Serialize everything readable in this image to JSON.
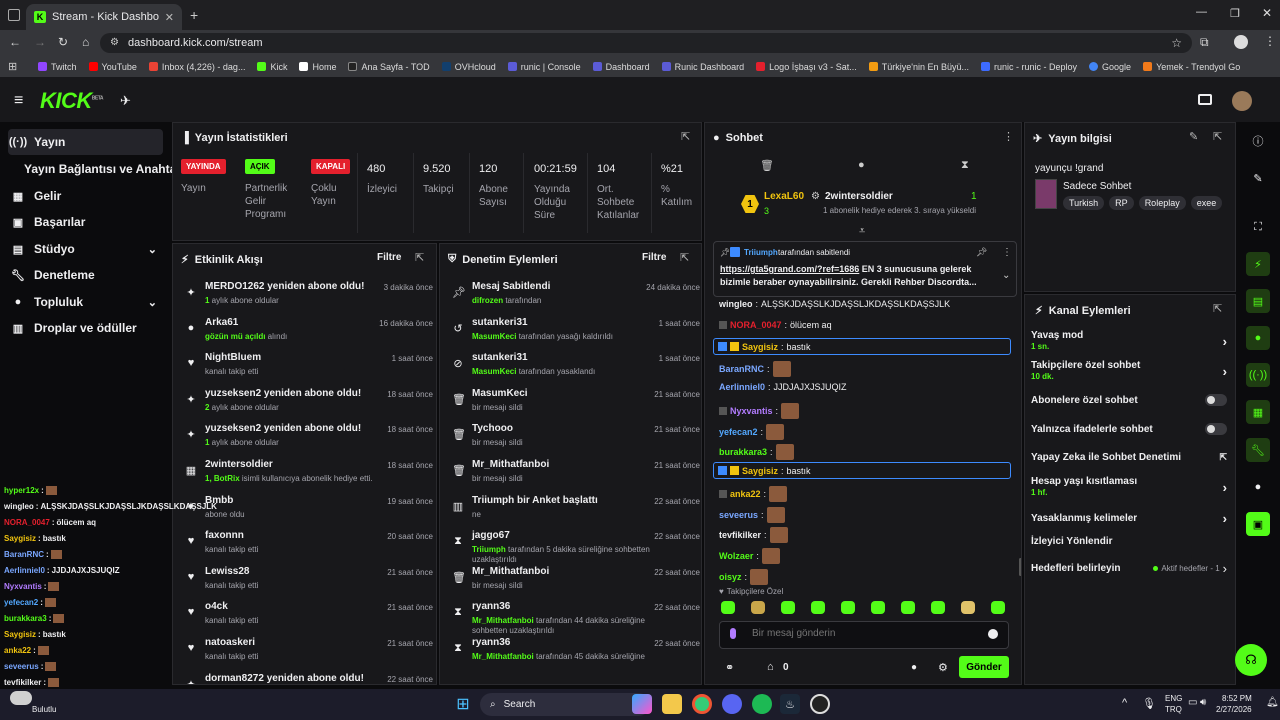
{
  "browser": {
    "tab_title": "Stream - Kick Dashboard",
    "url": "dashboard.kick.com/stream",
    "bookmarks": [
      "Twitch",
      "YouTube",
      "Inbox (4,226) - dag...",
      "Kick",
      "Home",
      "Ana Sayfa - TOD",
      "OVHcloud",
      "runic | Console",
      "Dashboard",
      "Runic Dashboard",
      "Logo İşbaşı v3 - Sat...",
      "Türkiye'nin En Büyü...",
      "runic - runic - Deploy",
      "Google",
      "Yemek - Trendyol Go"
    ]
  },
  "header": {
    "logo": "KICK",
    "beta": "BETA"
  },
  "sidebar": {
    "items": [
      {
        "label": "Yayın",
        "icon": "broadcast-icon"
      },
      {
        "label": "Yayın Bağlantısı ve Anahtarı",
        "icon": ""
      },
      {
        "label": "Gelir",
        "icon": "money-icon"
      },
      {
        "label": "Başarılar",
        "icon": "trophy-icon"
      },
      {
        "label": "Stüdyo",
        "icon": "studio-icon"
      },
      {
        "label": "Denetleme",
        "icon": "wrench-icon"
      },
      {
        "label": "Topluluk",
        "icon": "people-icon"
      },
      {
        "label": "Droplar ve ödüller",
        "icon": "gift-icon"
      }
    ]
  },
  "stats": {
    "title": "Yayın İstatistikleri",
    "items": [
      {
        "value": "YAYINDA",
        "label": "Yayın",
        "badge": true,
        "color": "#e4202d"
      },
      {
        "value": "AÇIK",
        "label": "Partnerlik Gelir Programı",
        "badge": true,
        "color": "#53fc18"
      },
      {
        "value": "KAPALI",
        "label": "Çoklu Yayın",
        "badge": true,
        "color": "#e4202d"
      },
      {
        "value": "480",
        "label": "İzleyici"
      },
      {
        "value": "9.520",
        "label": "Takipçi"
      },
      {
        "value": "120",
        "label": "Abone Sayısı"
      },
      {
        "value": "00:21:59",
        "label": "Yayında Olduğu Süre"
      },
      {
        "value": "104",
        "label": "Ort. Sohbete Katılanlar"
      },
      {
        "value": "%21",
        "label": "% Katılım"
      }
    ]
  },
  "activity": {
    "title": "Etkinlik Akışı",
    "filter": "Filtre",
    "items": [
      {
        "title": "MERDO1262 yeniden abone oldu!",
        "sub_g": "1",
        "sub": " aylık abone oldular",
        "time": "3 dakika önce",
        "icon": "sparkle-icon"
      },
      {
        "title": "Arka61",
        "sub_g": "gözün mü açıldı",
        "sub": " alındı",
        "time": "16 dakika önce",
        "icon": "reward-icon"
      },
      {
        "title": "NightBluem",
        "sub_g": "",
        "sub": "kanalı takip etti",
        "time": "1 saat önce",
        "icon": "heart-icon"
      },
      {
        "title": "yuzseksen2 yeniden abone oldu!",
        "sub_g": "2",
        "sub": " aylık abone oldular",
        "time": "18 saat önce",
        "icon": "sparkle-icon"
      },
      {
        "title": "yuzseksen2 yeniden abone oldu!",
        "sub_g": "1",
        "sub": " aylık abone oldular",
        "time": "18 saat önce",
        "icon": "sparkle-icon"
      },
      {
        "title": "2wintersoldier",
        "sub_g": "1, BotRix",
        "sub": " isimli kullanıcıya abonelik hediye etti.",
        "time": "18 saat önce",
        "icon": "gift-icon"
      },
      {
        "title": "Bmbb",
        "sub_g": "",
        "sub": "abone oldu",
        "time": "19 saat önce",
        "icon": "sparkle-icon"
      },
      {
        "title": "faxonnn",
        "sub_g": "",
        "sub": "kanalı takip etti",
        "time": "20 saat önce",
        "icon": "heart-icon"
      },
      {
        "title": "Lewiss28",
        "sub_g": "",
        "sub": "kanalı takip etti",
        "time": "21 saat önce",
        "icon": "heart-icon"
      },
      {
        "title": "o4ck",
        "sub_g": "",
        "sub": "kanalı takip etti",
        "time": "21 saat önce",
        "icon": "heart-icon"
      },
      {
        "title": "natoaskeri",
        "sub_g": "",
        "sub": "kanalı takip etti",
        "time": "21 saat önce",
        "icon": "heart-icon"
      },
      {
        "title": "dorman8272 yeniden abone oldu!",
        "sub_g": "",
        "sub": "",
        "time": "22 saat önce",
        "icon": "sparkle-icon"
      }
    ]
  },
  "moderation": {
    "title": "Denetim Eylemleri",
    "filter": "Filtre",
    "items": [
      {
        "title": "Mesaj Sabitlendi",
        "sub_g": "difrozen",
        "sub": " tarafından",
        "time": "24 dakika önce",
        "icon": "pin-icon"
      },
      {
        "title": "sutankeri31",
        "sub_g": "MasumKeci",
        "sub": " tarafından yasağı kaldırıldı",
        "time": "1 saat önce",
        "icon": "unban-icon"
      },
      {
        "title": "sutankeri31",
        "sub_g": "MasumKeci",
        "sub": " tarafından yasaklandı",
        "time": "1 saat önce",
        "icon": "ban-icon"
      },
      {
        "title": "MasumKeci",
        "sub_g": "",
        "sub": "bir mesajı sildi",
        "time": "21 saat önce",
        "icon": "trash-icon"
      },
      {
        "title": "Tychooo",
        "sub_g": "",
        "sub": "bir mesajı sildi",
        "time": "21 saat önce",
        "icon": "trash-icon"
      },
      {
        "title": "Mr_Mithatfanboi",
        "sub_g": "",
        "sub": "bir mesajı sildi",
        "time": "21 saat önce",
        "icon": "trash-icon"
      },
      {
        "title": "Triiumph bir Anket başlattı",
        "sub_g": "",
        "sub": "ne",
        "time": "22 saat önce",
        "icon": "poll-icon"
      },
      {
        "title": "jaggo67",
        "sub_g": "Triiumph",
        "sub": " tarafından 5 dakika süreliğine sohbetten uzaklaştırıldı",
        "time": "22 saat önce",
        "icon": "timer-icon"
      },
      {
        "title": "Mr_Mithatfanboi",
        "sub_g": "",
        "sub": "bir mesajı sildi",
        "time": "22 saat önce",
        "icon": "trash-icon"
      },
      {
        "title": "ryann36",
        "sub_g": "Mr_Mithatfanboi",
        "sub": " tarafından 44 dakika süreliğine sohbetten uzaklaştırıldı",
        "time": "22 saat önce",
        "icon": "timer-icon"
      },
      {
        "title": "ryann36",
        "sub_g": "Mr_Mithatfanboi",
        "sub": " tarafından 45 dakika süreliğine",
        "time": "22 saat önce",
        "icon": "timer-icon"
      }
    ]
  },
  "chat": {
    "title": "Sohbet",
    "leader1": {
      "name": "LexaL60",
      "count": "3"
    },
    "leader2": {
      "name": "2wintersoldier",
      "count": "1",
      "sub": "1 abonelik hediye ederek 3. sıraya yükseldi"
    },
    "pinned": {
      "user": "Triiumph",
      "by": "tarafından sabitlendi",
      "link": "https://gta5grand.com/?ref=1686",
      "text": " EN 3 sunucusuna gelerek bizimle beraber oynayabilirsiniz. Gerekli Rehber Discordta..."
    },
    "messages": [
      {
        "user": "wingleo",
        "color": "#efeff1",
        "text": "ALŞSKJDAŞSLKJDAŞSLJKDAŞSLKDAŞSJLK"
      },
      {
        "user": "NORA_0047",
        "color": "#e4202d",
        "text": "ölücem aq"
      },
      {
        "user": "Saygisiz",
        "color": "#f1c40f",
        "text": "bastık"
      },
      {
        "user": "BaranRNC",
        "color": "#7aa7ff",
        "text": ""
      },
      {
        "user": "Aerlinniel0",
        "color": "#7aa7ff",
        "text": "JJDJAJXJSJUQIZ"
      },
      {
        "user": "Nyxvantis",
        "color": "#b27cff",
        "text": ""
      },
      {
        "user": "yefecan2",
        "color": "#53a8ff",
        "text": ""
      },
      {
        "user": "burakkara3",
        "color": "#53fc18",
        "text": ""
      },
      {
        "user": "Saygisiz",
        "color": "#f1c40f",
        "text": "bastık"
      },
      {
        "user": "anka22",
        "color": "#f1c40f",
        "text": ""
      },
      {
        "user": "seveerus",
        "color": "#7aa7ff",
        "text": ""
      },
      {
        "user": "tevfikilker",
        "color": "#efeff1",
        "text": ""
      },
      {
        "user": "Wolzaer",
        "color": "#53fc18",
        "text": ""
      },
      {
        "user": "oisyz",
        "color": "#53fc18",
        "text": ""
      }
    ],
    "emote_label": "Takipçilere Özel",
    "input_placeholder": "Bir mesaj gönderin",
    "points": "0",
    "send": "Gönder"
  },
  "stream_info": {
    "title": "Yayın bilgisi",
    "streamer": "yayunçu !grand",
    "category": "Sadece Sohbet",
    "tags": [
      "Turkish",
      "RP",
      "Roleplay",
      "exee"
    ]
  },
  "channel_actions": {
    "title": "Kanal Eylemleri",
    "items": [
      {
        "label": "Yavaş mod",
        "sub": "1 sn.",
        "type": "arrow"
      },
      {
        "label": "Takipçilere özel sohbet",
        "sub": "10 dk.",
        "type": "arrow"
      },
      {
        "label": "Abonelere özel sohbet",
        "sub": "",
        "type": "toggle"
      },
      {
        "label": "Yalnızca ifadelerle sohbet",
        "sub": "",
        "type": "toggle"
      },
      {
        "label": "Yapay Zeka ile Sohbet Denetimi",
        "sub": "",
        "type": "ext"
      },
      {
        "label": "Hesap yaşı kısıtlaması",
        "sub": "1 hf.",
        "type": "arrow"
      },
      {
        "label": "Yasaklanmış kelimeler",
        "sub": "",
        "type": "arrow"
      },
      {
        "label": "İzleyici Yönlendir",
        "sub": "",
        "type": "none"
      },
      {
        "label": "Hedefleri belirleyin",
        "sub": "",
        "type": "goal",
        "extra": "Aktif hedefler - 1"
      }
    ]
  },
  "overlay_chat": [
    {
      "user": "hyper12x",
      "color": "#53fc18",
      "text": ""
    },
    {
      "user": "wingleo",
      "color": "#efeff1",
      "text": "ALŞSKJDAŞSLKJDAŞSLJKDAŞSLKDAŞSJLK"
    },
    {
      "user": "NORA_0047",
      "color": "#e4202d",
      "text": "ölücem aq"
    },
    {
      "user": "Saygisiz",
      "color": "#f1c40f",
      "text": "bastık"
    },
    {
      "user": "BaranRNC",
      "color": "#7aa7ff",
      "text": ""
    },
    {
      "user": "Aerlinniel0",
      "color": "#7aa7ff",
      "text": "JJDJAJXJSJUQIZ"
    },
    {
      "user": "Nyxvantis",
      "color": "#b27cff",
      "text": ""
    },
    {
      "user": "yefecan2",
      "color": "#53a8ff",
      "text": ""
    },
    {
      "user": "burakkara3",
      "color": "#53fc18",
      "text": ""
    },
    {
      "user": "Saygisiz",
      "color": "#f1c40f",
      "text": "bastık"
    },
    {
      "user": "anka22",
      "color": "#f1c40f",
      "text": ""
    },
    {
      "user": "seveerus",
      "color": "#7aa7ff",
      "text": ""
    },
    {
      "user": "tevfikilker",
      "color": "#efeff1",
      "text": ""
    },
    {
      "user": "Wolzaer",
      "color": "#53fc18",
      "text": ""
    },
    {
      "user": "oisyz",
      "color": "#53fc18",
      "text": ""
    }
  ],
  "taskbar": {
    "search": "Search",
    "lang1": "ENG",
    "lang2": "TRQ",
    "time": "8:52 PM",
    "date": "2/27/2026",
    "weather": "Bulutlu"
  },
  "colors": {
    "accent": "#53fc18",
    "live": "#e4202d",
    "panel": "#18181b"
  }
}
